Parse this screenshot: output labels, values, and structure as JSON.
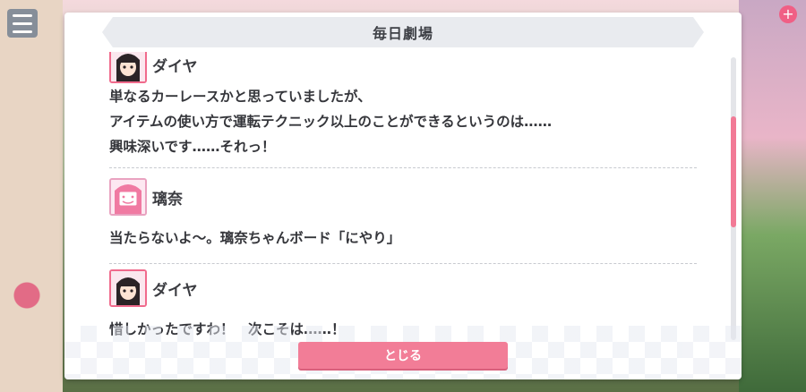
{
  "dialog": {
    "title": "毎日劇場",
    "close_label": "とじる"
  },
  "entries": [
    {
      "speaker": "ダイヤ",
      "avatar": "dia-avatar",
      "lines": [
        "単なるカーレースかと思っていましたが、",
        "アイテムの使い方で運転テクニック以上のことができるというのは……",
        "興味深いです……それっ！"
      ]
    },
    {
      "speaker": "璃奈",
      "avatar": "rina-avatar",
      "lines": [
        "当たらないよ〜。璃奈ちゃんボード「にやり」"
      ]
    },
    {
      "speaker": "ダイヤ",
      "avatar": "dia-avatar",
      "lines": [
        "惜しかったですわ！　次こそは……！"
      ]
    }
  ],
  "colors": {
    "accent": "#f27d97",
    "avatar_border": "#f06a8c",
    "title_bg": "#e9ebef"
  },
  "scroll": {
    "position_fraction": 0.25
  }
}
